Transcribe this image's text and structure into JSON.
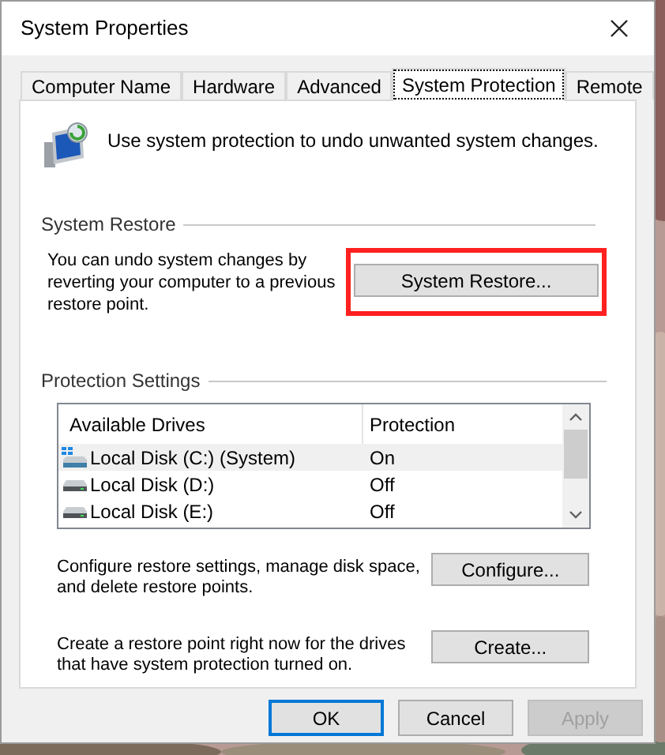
{
  "window": {
    "title": "System Properties"
  },
  "tabs": [
    {
      "label": "Computer Name",
      "selected": false
    },
    {
      "label": "Hardware",
      "selected": false
    },
    {
      "label": "Advanced",
      "selected": false
    },
    {
      "label": "System Protection",
      "selected": true
    },
    {
      "label": "Remote",
      "selected": false
    }
  ],
  "intro": "Use system protection to undo unwanted system changes.",
  "system_restore": {
    "title": "System Restore",
    "text": "You can undo system changes by reverting your computer to a previous restore point.",
    "button": {
      "label": "System Restore...",
      "highlighted": true
    }
  },
  "protection_settings": {
    "title": "Protection Settings",
    "columns": [
      "Available Drives",
      "Protection"
    ],
    "rows": [
      {
        "kind": "system",
        "drive": "Local Disk (C:) (System)",
        "protection": "On",
        "selected": true
      },
      {
        "kind": "disk",
        "drive": "Local Disk (D:)",
        "protection": "Off",
        "selected": false
      },
      {
        "kind": "disk",
        "drive": "Local Disk (E:)",
        "protection": "Off",
        "selected": false
      }
    ],
    "actions": [
      {
        "text": "Configure restore settings, manage disk space, and delete restore points.",
        "button": "Configure..."
      },
      {
        "text": "Create a restore point right now for the drives that have system protection turned on.",
        "button": "Create..."
      }
    ]
  },
  "buttons": [
    {
      "label": "OK",
      "default": true,
      "disabled": false
    },
    {
      "label": "Cancel",
      "default": false,
      "disabled": false
    },
    {
      "label": "Apply",
      "default": false,
      "disabled": true
    }
  ]
}
